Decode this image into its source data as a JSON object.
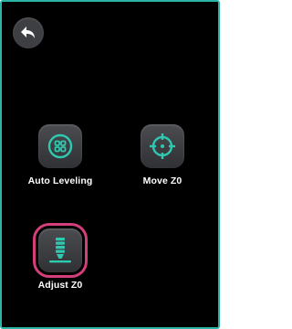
{
  "header": {
    "back_icon": "back-arrow-icon"
  },
  "tiles": [
    {
      "label": "Auto Leveling",
      "icon": "grid-dots-icon",
      "selected": false
    },
    {
      "label": "Move Z0",
      "icon": "crosshair-icon",
      "selected": false
    },
    {
      "label": "Adjust Z0",
      "icon": "nozzle-icon",
      "selected": true
    }
  ],
  "colors": {
    "accent": "#2bb3a8",
    "icon_green": "#2ec9b0",
    "selection": "#d23f7a",
    "background": "#000000"
  }
}
